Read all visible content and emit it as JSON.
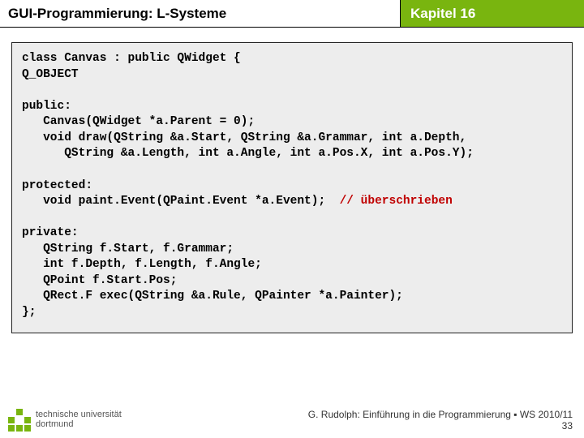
{
  "header": {
    "left": "GUI-Programmierung: L-Systeme",
    "right": "Kapitel 16"
  },
  "code": {
    "l1": "class Canvas : public QWidget {",
    "l2": "Q_OBJECT",
    "l3": "",
    "l4": "public:",
    "l5": "   Canvas(QWidget *a.Parent = 0);",
    "l6": "   void draw(QString &a.Start, QString &a.Grammar, int a.Depth,",
    "l7": "      QString &a.Length, int a.Angle, int a.Pos.X, int a.Pos.Y);",
    "l8": "",
    "l9": "protected:",
    "l10": "   void paint.Event(QPaint.Event *a.Event);  ",
    "l10c": "// überschrieben",
    "l11": "",
    "l12": "private:",
    "l13": "   QString f.Start, f.Grammar;",
    "l14": "   int f.Depth, f.Length, f.Angle;",
    "l15": "   QPoint f.Start.Pos;",
    "l16": "   QRect.F exec(QString &a.Rule, QPainter *a.Painter);",
    "l17": "};"
  },
  "footer": {
    "uni_line1": "technische universität",
    "uni_line2": "dortmund",
    "credit": "G. Rudolph: Einführung in die Programmierung ▪ WS 2010/11",
    "page": "33"
  }
}
